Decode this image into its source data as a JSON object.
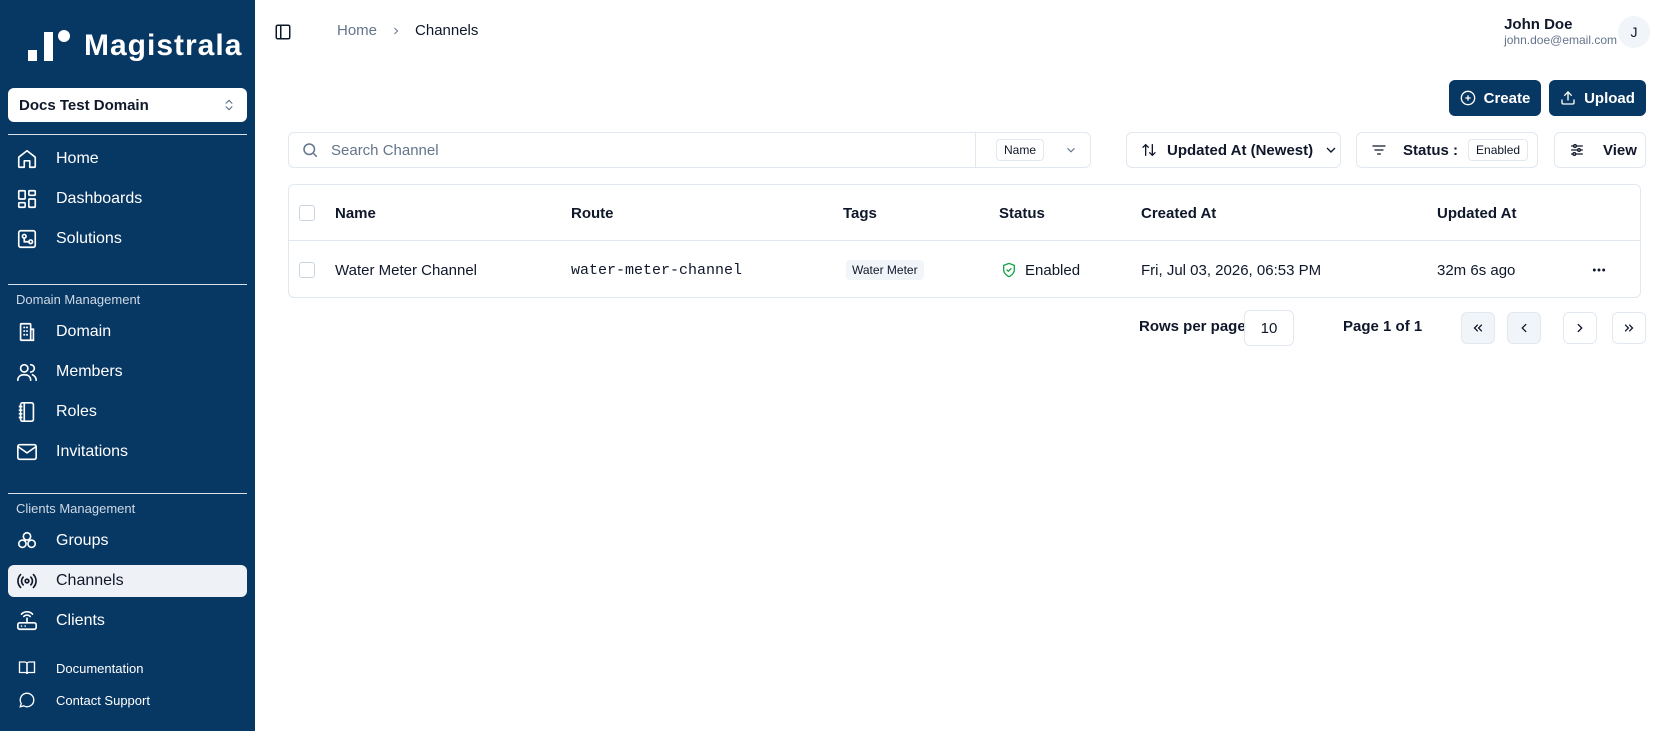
{
  "app": {
    "name": "Magistrala"
  },
  "sidebar": {
    "domain_selector": "Docs Test Domain",
    "main_items": [
      {
        "label": "Home",
        "icon": "home-icon"
      },
      {
        "label": "Dashboards",
        "icon": "dashboard-icon"
      },
      {
        "label": "Solutions",
        "icon": "solutions-icon"
      }
    ],
    "domain_section": {
      "title": "Domain Management",
      "items": [
        {
          "label": "Domain",
          "icon": "building-icon"
        },
        {
          "label": "Members",
          "icon": "users-icon"
        },
        {
          "label": "Roles",
          "icon": "notebook-icon"
        },
        {
          "label": "Invitations",
          "icon": "mail-icon"
        }
      ]
    },
    "clients_section": {
      "title": "Clients Management",
      "items": [
        {
          "label": "Groups",
          "icon": "groups-icon"
        },
        {
          "label": "Channels",
          "icon": "radio-icon",
          "active": true
        },
        {
          "label": "Clients",
          "icon": "router-icon"
        }
      ]
    },
    "footer_items": [
      {
        "label": "Documentation",
        "icon": "book-icon"
      },
      {
        "label": "Contact Support",
        "icon": "chat-icon"
      }
    ]
  },
  "header": {
    "breadcrumb": [
      "Home",
      "Channels"
    ],
    "user": {
      "name": "John Doe",
      "email": "john.doe@email.com",
      "initial": "J"
    }
  },
  "actions": {
    "create": "Create",
    "upload": "Upload"
  },
  "toolbar": {
    "search_placeholder": "Search Channel",
    "search_field": "Name",
    "sort": "Updated At (Newest)",
    "status_label": "Status :",
    "status_value": "Enabled",
    "view": "View"
  },
  "table": {
    "columns": [
      "Name",
      "Route",
      "Tags",
      "Status",
      "Created At",
      "Updated At"
    ],
    "rows": [
      {
        "name": "Water Meter Channel",
        "route": "water-meter-channel",
        "tag": "Water Meter",
        "status": "Enabled",
        "created_at": "Fri, Jul 03, 2026, 06:53 PM",
        "updated_at": "32m 6s ago"
      }
    ]
  },
  "pagination": {
    "rows_per_page_label": "Rows per page",
    "rows_per_page": "10",
    "page_label": "Page 1 of 1"
  },
  "colors": {
    "sidebar_bg": "#073763",
    "primary": "#073763",
    "success": "#16a34a"
  }
}
